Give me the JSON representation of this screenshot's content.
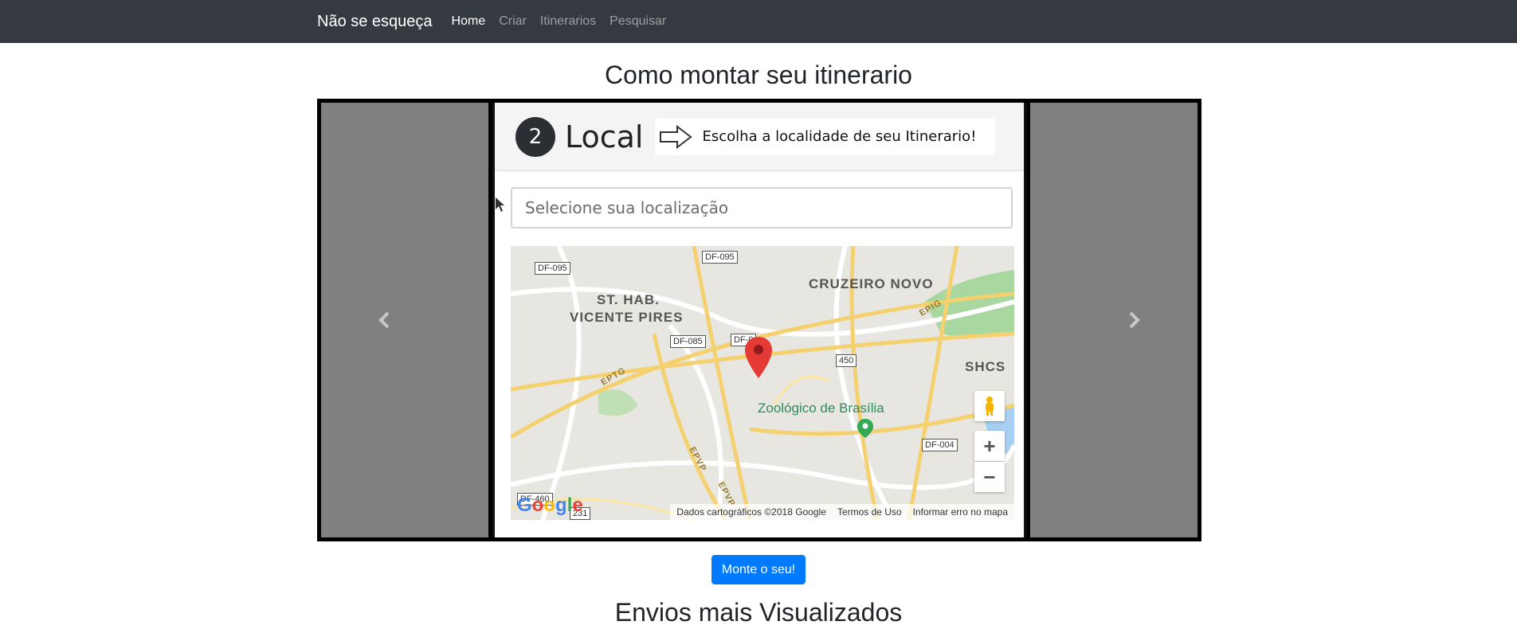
{
  "navbar": {
    "brand": "Não se esqueça",
    "links": [
      {
        "label": "Home",
        "active": true
      },
      {
        "label": "Criar",
        "active": false
      },
      {
        "label": "Itinerarios",
        "active": false
      },
      {
        "label": "Pesquisar",
        "active": false
      }
    ]
  },
  "howto": {
    "title": "Como montar seu itinerario",
    "slide": {
      "step_number": "2",
      "step_title": "Local",
      "hint": "Escolha a localidade de seu Itinerario!",
      "input_placeholder": "Selecione sua localização",
      "map": {
        "labels": [
          "ST. HAB.",
          "VICENTE PIRES",
          "CRUZEIRO NOVO",
          "SHCS"
        ],
        "poi": "Zoológico de Brasília",
        "road_tags": [
          "DF-095",
          "DF-095",
          "DF-085",
          "DF-0",
          "450",
          "DF-004",
          "DF-460",
          "231"
        ],
        "road_names": [
          "EPTG",
          "EPIG",
          "EPVP",
          "EPVP"
        ],
        "zoom_in": "+",
        "zoom_out": "−",
        "logo": "Google",
        "footer": [
          "Dados cartográficos ©2018 Google",
          "Termos de Uso",
          "Informar erro no mapa"
        ]
      }
    },
    "controls": {
      "prev_icon": "chevron-left-icon",
      "next_icon": "chevron-right-icon"
    }
  },
  "cta": {
    "label": "Monte o seu!",
    "color": "#007bff"
  },
  "most_viewed": {
    "title": "Envios mais Visualizados"
  },
  "colors": {
    "navbar": "#343a40",
    "carousel_side": "#808080"
  }
}
